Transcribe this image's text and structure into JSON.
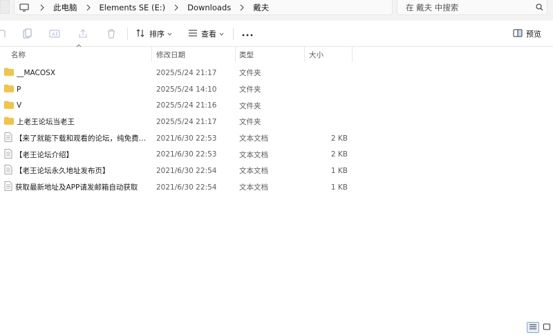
{
  "address_bar": {
    "crumbs": [
      "此电脑",
      "Elements SE (E:)",
      "Downloads",
      "戴夫"
    ]
  },
  "search": {
    "placeholder": "在 戴夫 中搜索"
  },
  "toolbar": {
    "sort_label": "排序",
    "view_label": "查看",
    "preview_label": "预览"
  },
  "columns": {
    "name": "名称",
    "date": "修改日期",
    "type": "类型",
    "size": "大小"
  },
  "files": [
    {
      "name": "__MACOSX",
      "date": "2025/5/24 21:17",
      "type": "文件夹",
      "size": "",
      "icon": "folder-icon"
    },
    {
      "name": "P",
      "date": "2025/5/24 14:10",
      "type": "文件夹",
      "size": "",
      "icon": "folder-icon"
    },
    {
      "name": "V",
      "date": "2025/5/24 21:16",
      "type": "文件夹",
      "size": "",
      "icon": "folder-icon"
    },
    {
      "name": "上老王论坛当老王",
      "date": "2025/5/24 21:17",
      "type": "文件夹",
      "size": "",
      "icon": "folder-icon"
    },
    {
      "name": "【来了就能下载和观看的论坛，纯免费！...",
      "date": "2021/6/30 22:53",
      "type": "文本文档",
      "size": "2 KB",
      "icon": "text-file-icon"
    },
    {
      "name": "【老王论坛介绍】",
      "date": "2021/6/30 22:53",
      "type": "文本文档",
      "size": "2 KB",
      "icon": "text-file-icon"
    },
    {
      "name": "【老王论坛永久地址发布页】",
      "date": "2021/6/30 22:54",
      "type": "文本文档",
      "size": "1 KB",
      "icon": "text-file-icon"
    },
    {
      "name": "获取最新地址及APP请发邮箱自动获取",
      "date": "2021/6/30 22:54",
      "type": "文本文档",
      "size": "1 KB",
      "icon": "text-file-icon"
    }
  ],
  "colors": {
    "folder": "#f4c542",
    "folder_dark": "#e3a91f",
    "accent": "#3b73c4"
  }
}
